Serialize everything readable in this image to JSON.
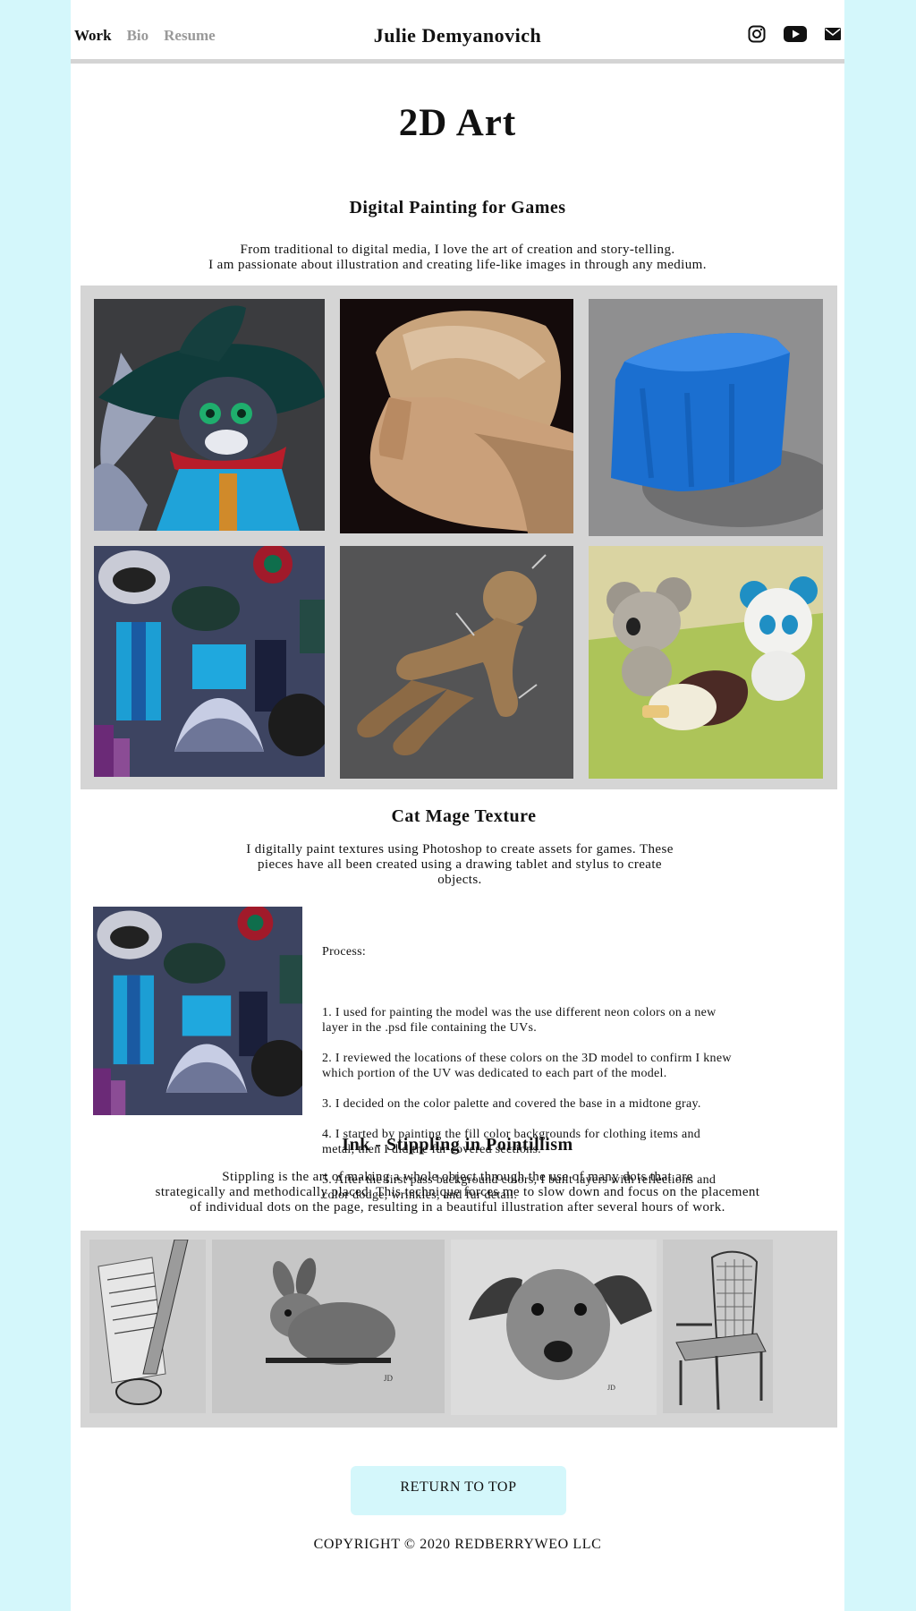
{
  "header": {
    "nav": [
      {
        "label": "Work",
        "active": true
      },
      {
        "label": "Bio",
        "active": false
      },
      {
        "label": "Resume",
        "active": false
      }
    ],
    "site_title": "Julie Demyanovich",
    "social_icons": [
      "instagram-icon",
      "youtube-icon",
      "mail-icon"
    ]
  },
  "page_title": "2D Art",
  "digital": {
    "heading": "Digital Painting for Games",
    "line1": "From traditional to digital media, I love the art of creation and story-telling.",
    "line2": "I am passionate about illustration and creating life-like images in through any medium.",
    "tiles": [
      "cat-mage-render",
      "old-man-portrait",
      "blue-cloth-box",
      "cat-mage-texture-sheet",
      "voodoo-doll",
      "koala-panda-icecream"
    ]
  },
  "cat_mage": {
    "heading": "Cat Mage Texture",
    "desc_1": "I digitally paint textures using Photoshop to create assets for games. These",
    "desc_2": "pieces have all been created using a drawing tablet and stylus to create",
    "desc_3": "objects.",
    "process_title": "Process:",
    "steps": [
      "1. I used for painting the model was the use different neon colors on a new\nlayer in the .psd file containing the UVs.",
      "2. I reviewed the locations of these colors on the 3D model to confirm I knew\n which portion of the UV was dedicated to each part of the model.",
      "3. I decided on the color palette and covered the base in a midtone gray.",
      "4. I started by painting the fill color backgrounds for clothing items and\nmetal, then I did the fur covered sections.",
      "5. After the first pass background colors, I built layers with reflections and\ncolor dodge, wrinkles, and fur detail."
    ]
  },
  "ink": {
    "heading": "Ink - Stippling in Pointillism",
    "line1": "Stippling is the art of making a whole object through the use of many dots that are",
    "line2": "strategically and methodically placed. This technique forces me to slow down and focus on the placement",
    "line3": "of individual dots on the page, resulting in a beautiful illustration after several hours of work."
  },
  "footer": {
    "return_label": "RETURN TO TOP",
    "copyright": "COPYRIGHT © 2020 REDBERRYWEO LLC"
  },
  "colors": {
    "background": "#d4f7fb",
    "gallery_bg": "#d5d5d5",
    "nav_inactive": "#9a9a9a"
  }
}
